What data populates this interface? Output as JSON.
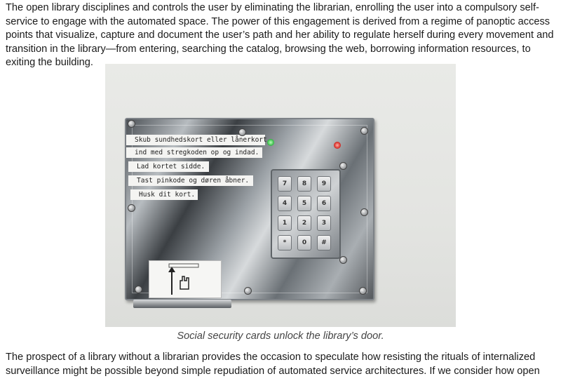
{
  "article": {
    "paragraph_1": "The open library disciplines and controls the user by eliminating the librarian, enrolling the user into a compulsory self-service to engage with the automated space. The power of this engagement is derived from a regime of panoptic access points that visualize, capture and document the user’s path and her ability to regulate herself during every movement and transition in the library—from entering, searching the catalog, browsing the web, borrowing information resources, to exiting the building.",
    "paragraph_2": "The prospect of a library without a librarian provides the occasion to speculate how resisting the rituals of internalized surveillance might be possible beyond simple repudiation of automated service architectures. If we consider how open"
  },
  "figure": {
    "caption": "Social security cards unlock the library’s door.",
    "sign_lines": [
      "Skub sundhedskort eller lånerkort",
      "ind med stregkoden op og indad.",
      "Lad kortet sidde.",
      "Tast pinkode og døren åbner.",
      "Husk dit kort."
    ],
    "keypad_keys": [
      "7",
      "8",
      "9",
      "4",
      "5",
      "6",
      "1",
      "2",
      "3",
      "*",
      "0",
      "#"
    ],
    "colors": {
      "led_green": "#3fbf4f",
      "led_red": "#d8312b",
      "plate": "#a9aeb2"
    }
  }
}
